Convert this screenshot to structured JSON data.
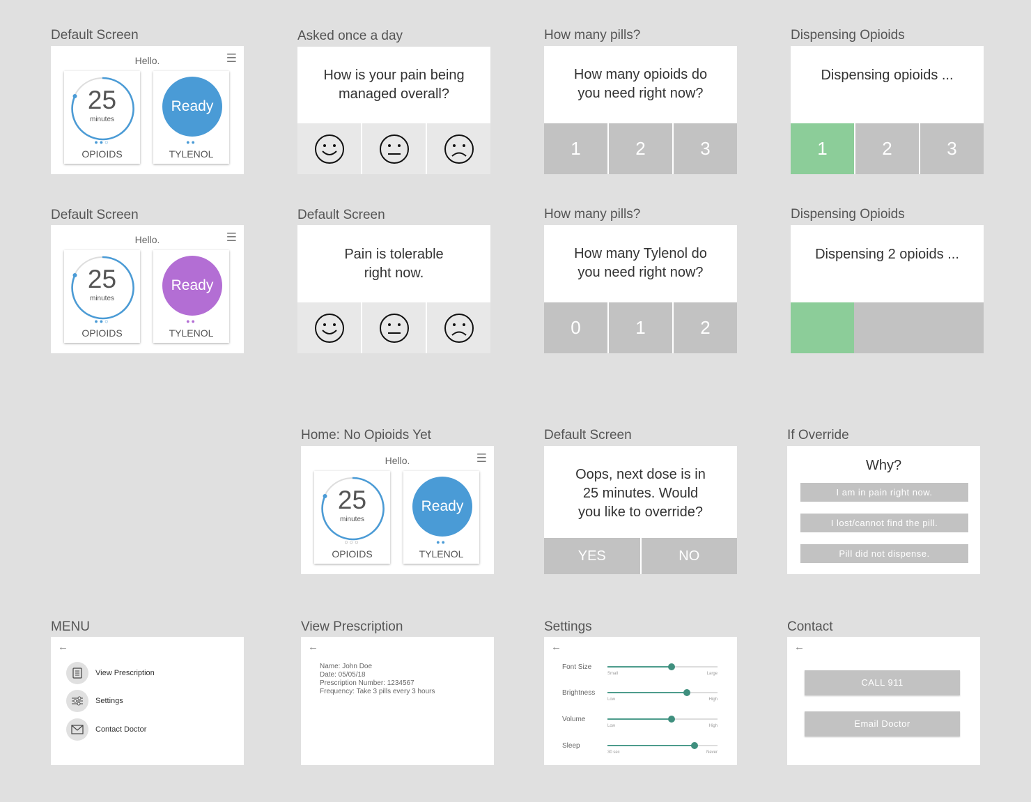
{
  "colors": {
    "blue": "#4a9bd6",
    "purple": "#b36ed4",
    "green": "#8ccd99",
    "grey": "#c2c2c2"
  },
  "labels": {
    "r1c1": "Default Screen",
    "r1c2": "Asked once a day",
    "r1c3": "How many pills?",
    "r1c4": "Dispensing Opioids",
    "r2c1": "Default Screen",
    "r2c2": "Default Screen",
    "r2c3": "How many pills?",
    "r2c4": "Dispensing Opioids",
    "r3c2": "Home: No Opioids Yet",
    "r3c3": "Default Screen",
    "r3c4": "If Override",
    "r4c1": "MENU",
    "r4c2": "View Prescription",
    "r4c3": "Settings",
    "r4c4": "Contact"
  },
  "home": {
    "hello": "Hello.",
    "minutes_value": "25",
    "minutes_unit": "minutes",
    "ready": "Ready",
    "opioids": "OPIOIDS",
    "tylenol": "TYLENOL",
    "dots_full": "●●○",
    "dots_two": "●●",
    "dots_empty": "○○○"
  },
  "pain": {
    "q1": "How is your pain being managed overall?",
    "q2": "Pain is tolerable right now.",
    "faces": [
      "happy-face-icon",
      "neutral-face-icon",
      "sad-face-icon"
    ]
  },
  "pills": {
    "q_opioids": "How many opioids do you need right now?",
    "q_tylenol": "How many Tylenol do you need right now?",
    "opioid_options": [
      "1",
      "2",
      "3"
    ],
    "tylenol_options": [
      "0",
      "1",
      "2"
    ]
  },
  "dispense": {
    "text1": "Dispensing opioids ...",
    "text2": "Dispensing 2 opioids ...",
    "options": [
      "1",
      "2",
      "3"
    ],
    "selected": "1",
    "progress_fraction": 0.33
  },
  "override": {
    "question": "Oops, next dose is in 25 minutes. Would you like to override?",
    "yes": "YES",
    "no": "NO"
  },
  "why": {
    "title": "Why?",
    "reasons": [
      "I am in pain right now.",
      "I lost/cannot find the pill.",
      "Pill did not dispense."
    ]
  },
  "menu": {
    "items": [
      "View Prescription",
      "Settings",
      "Contact Doctor"
    ]
  },
  "prescription": {
    "lines": [
      "Name: John Doe",
      "Date: 05/05/18",
      "Prescription Number: 1234567",
      "Frequency: Take 3 pills every 3 hours"
    ]
  },
  "settings": {
    "rows": [
      {
        "name": "Font Size",
        "min": "Small",
        "max": "Large",
        "value": 0.58
      },
      {
        "name": "Brightness",
        "min": "Low",
        "max": "High",
        "value": 0.72
      },
      {
        "name": "Volume",
        "min": "Low",
        "max": "High",
        "value": 0.58
      },
      {
        "name": "Sleep",
        "min": "30 sec",
        "max": "Never",
        "value": 0.79
      }
    ]
  },
  "contact": {
    "call": "CALL 911",
    "email": "Email Doctor"
  }
}
